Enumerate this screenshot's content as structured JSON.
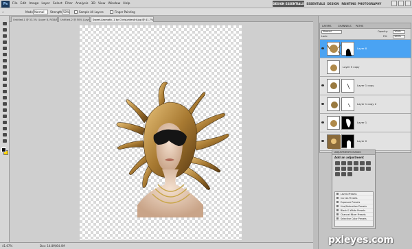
{
  "app": {
    "logo": "Ps",
    "menu": [
      "File",
      "Edit",
      "Image",
      "Layer",
      "Select",
      "Filter",
      "Analysis",
      "3D",
      "View",
      "Window",
      "Help"
    ],
    "workspaces": [
      "DESIGN ESSENTIALS",
      "ESSENTIALS",
      "DESIGN",
      "PAINTING",
      "PHOTOGRAPHY"
    ],
    "active_workspace": "DESIGN ESSENTIALS"
  },
  "options": {
    "mode_label": "Mode:",
    "mode_value": "Normal",
    "strength_label": "Strength:",
    "strength_value": "50%",
    "sample_all": "Sample All Layers",
    "finger_painting": "Finger Painting"
  },
  "tabs": [
    {
      "label": "Untitled-1 @ 33.3% (Layer 8, RGB/8#)",
      "active": false
    },
    {
      "label": "Untitled-2 @ 50% (Layer 3, RGB/8#)",
      "active": false
    },
    {
      "label": "Sweet-Aromatic_1 by ChrisLetterArt.jpg @ 41.7% (Layer 8, RGB/8#)",
      "active": true
    }
  ],
  "status": {
    "zoom": "41.67%",
    "doc": "Doc: 14.8M/64.4M"
  },
  "layers_panel": {
    "tabs": [
      "LAYERS",
      "CHANNELS",
      "PATHS"
    ],
    "blend_label": "Normal",
    "opacity_label": "Opacity:",
    "opacity_value": "100%",
    "lock_label": "Lock:",
    "fill_label": "Fill:",
    "fill_value": "100%",
    "layers": [
      {
        "name": "Layer 8",
        "selected": true,
        "visible": true
      },
      {
        "name": "Layer 5 copy",
        "selected": false,
        "visible": false
      },
      {
        "name": "Layer 1 copy",
        "selected": false,
        "visible": true
      },
      {
        "name": "Layer 1 copy 2",
        "selected": false,
        "visible": true
      },
      {
        "name": "Layer 1",
        "selected": false,
        "visible": true
      },
      {
        "name": "Layer 0",
        "selected": false,
        "visible": true
      }
    ]
  },
  "adjustments_panel": {
    "tab": "ADJUSTMENTS MASKS",
    "title": "Add an adjustment",
    "presets": [
      "Levels Presets",
      "Curves Presets",
      "Exposure Presets",
      "Hue/Saturation Presets",
      "Black & White Presets",
      "Channel Mixer Presets",
      "Selective Color Presets"
    ]
  },
  "watermark": "pxleyes.com",
  "colors": {
    "foreground": "#111111",
    "background": "#ffd200",
    "selected_layer": "#4aa3f3"
  }
}
